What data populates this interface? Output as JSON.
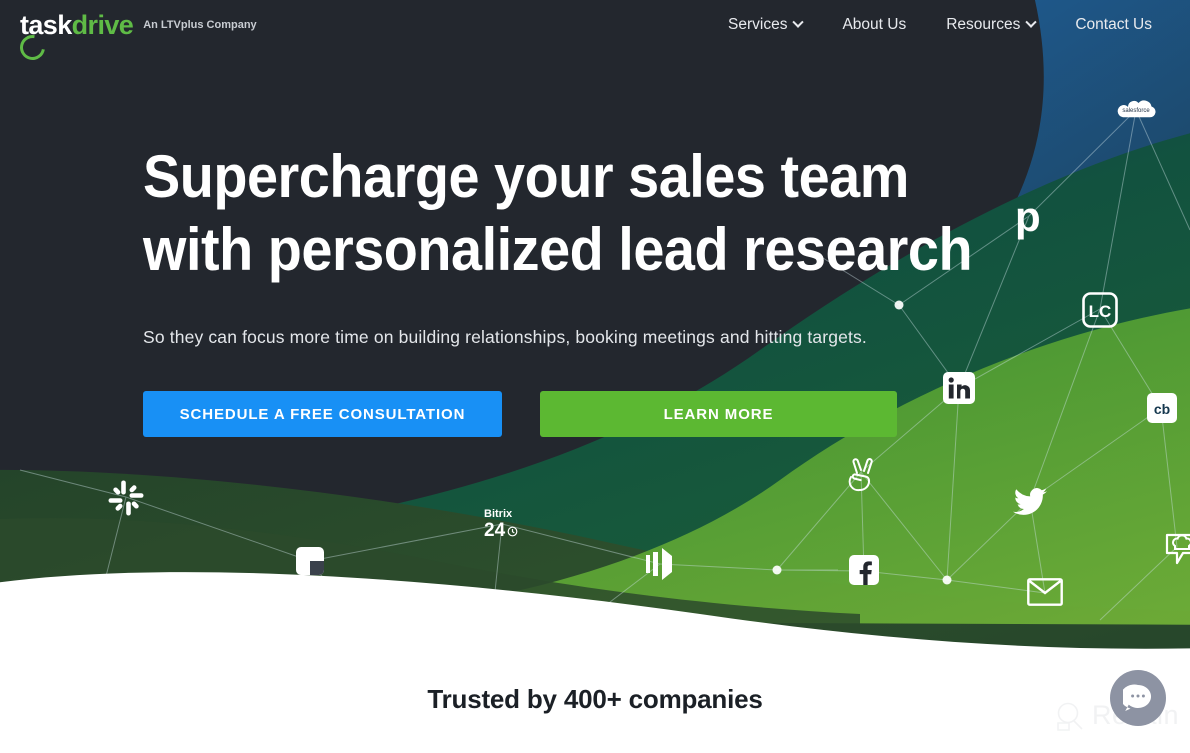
{
  "brand": {
    "logo_task": "task",
    "logo_drive": "drive",
    "logo_tagline": "An LTVplus Company",
    "green": "#5FBB46",
    "blue": "#1890F5",
    "dark": "#23272E"
  },
  "nav": {
    "items": [
      {
        "label": "Services",
        "has_caret": true
      },
      {
        "label": "About Us",
        "has_caret": false
      },
      {
        "label": "Resources",
        "has_caret": true
      },
      {
        "label": "Contact Us",
        "has_caret": false
      }
    ]
  },
  "hero": {
    "headline_line1": "Supercharge your sales team",
    "headline_line2": "with personalized lead research",
    "subhead": "So they can focus more time on building relationships, booking meetings and hitting targets.",
    "cta_primary": "SCHEDULE A FREE CONSULTATION",
    "cta_secondary": "LEARN MORE",
    "integration_logos": [
      "salesforce-cloud-icon",
      "pipedrive-p-icon",
      "livechat-lc-icon",
      "linkedin-icon",
      "crunchbase-cb-icon",
      "twitter-bird-icon",
      "angellist-icon",
      "facebook-icon",
      "email-envelope-icon",
      "slack-icon",
      "asana-square-icon",
      "bitrix24-icon",
      "pipedrive-bars-icon",
      "chefhat-bubble-icon"
    ]
  },
  "trusted": {
    "headline": "Trusted by 400+ companies"
  },
  "watermark": {
    "label": "Revain"
  },
  "chat": {
    "label": "chat-bubble-icon"
  },
  "bitrix": {
    "line1": "Bitrix",
    "line2": "24"
  },
  "logos_text": {
    "salesforce": "salesforce",
    "pipedrive_p": "p",
    "livechat": "LC",
    "linkedin": "in",
    "crunchbase": "cb"
  }
}
